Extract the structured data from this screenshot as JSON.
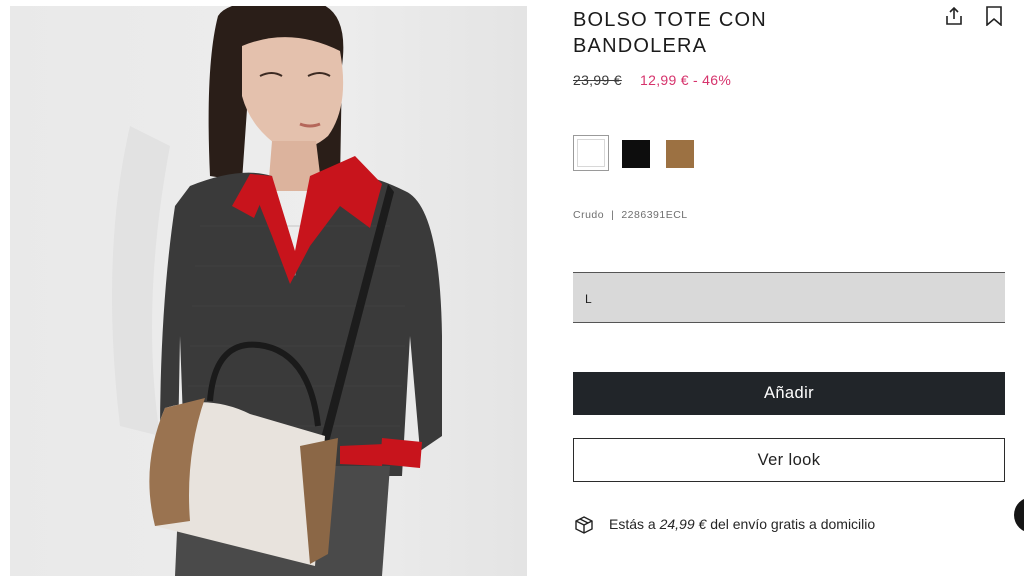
{
  "product": {
    "title": "BOLSO TOTE CON BANDOLERA",
    "old_price": "23,99 €",
    "new_price": "12,99 € - 46%",
    "color_name": "Crudo",
    "separator": "|",
    "reference": "2286391ECL",
    "size_value": "L"
  },
  "swatches": [
    {
      "name": "white",
      "color": "#ffffff",
      "selected": true
    },
    {
      "name": "black",
      "color": "#0d0d0d",
      "selected": false
    },
    {
      "name": "tan",
      "color": "#9c7142",
      "selected": false
    }
  ],
  "actions": {
    "add_label": "Añadir",
    "look_label": "Ver look"
  },
  "shipping": {
    "prefix": "Estás a",
    "amount": "24,99 €",
    "suffix": "del envío gratis a domicilio"
  },
  "icons": {
    "share": "share-icon",
    "bookmark": "bookmark-icon",
    "shipping": "box-icon",
    "chat": "chat-icon"
  },
  "colors": {
    "accent_price": "#d6336c",
    "primary_button": "#212529"
  }
}
